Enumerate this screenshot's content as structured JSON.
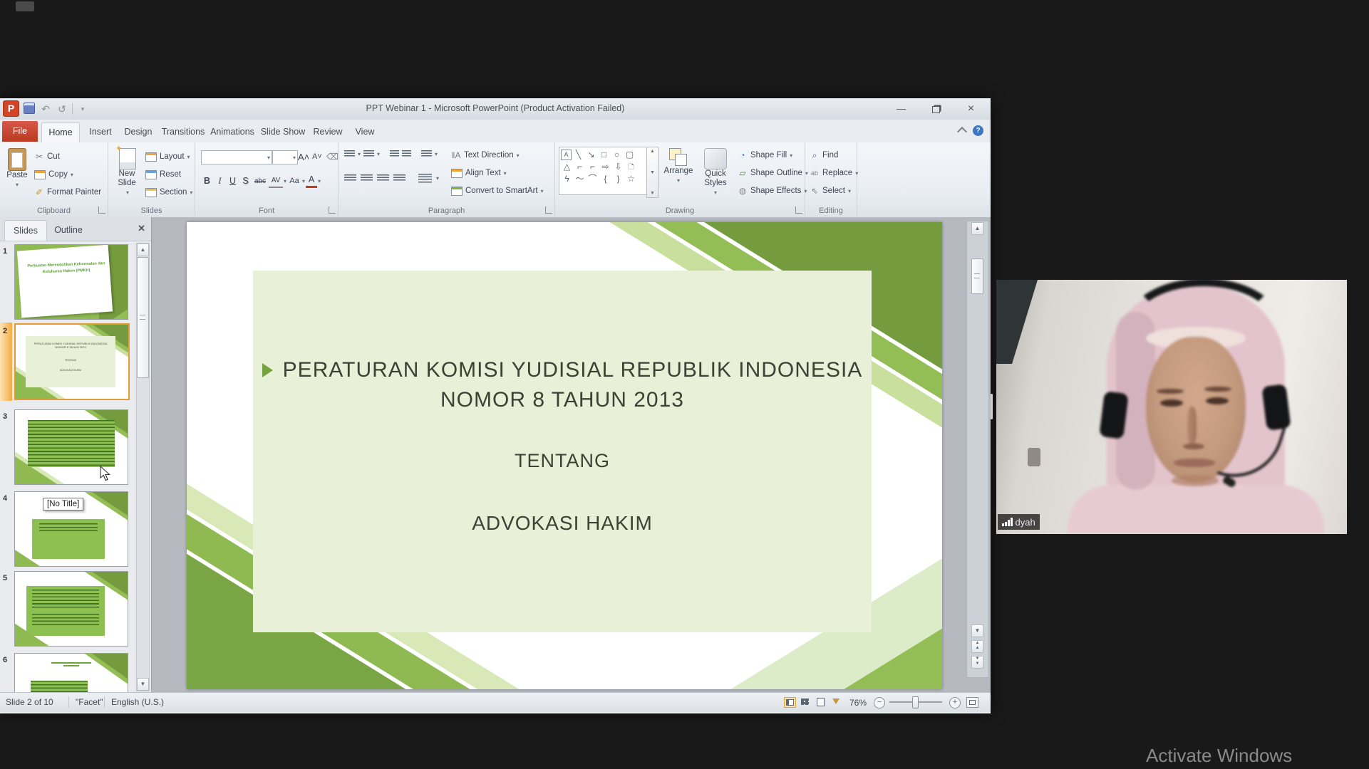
{
  "titlebar": {
    "title": "PPT Webinar 1 - Microsoft PowerPoint (Product Activation Failed)"
  },
  "tabs": {
    "file": "File",
    "items": [
      "Home",
      "Insert",
      "Design",
      "Transitions",
      "Animations",
      "Slide Show",
      "Review",
      "View"
    ]
  },
  "ribbon": {
    "clipboard": {
      "label": "Clipboard",
      "paste": "Paste",
      "cut": "Cut",
      "copy": "Copy",
      "format_painter": "Format Painter"
    },
    "slides": {
      "label": "Slides",
      "new_slide": "New Slide",
      "layout": "Layout",
      "reset": "Reset",
      "section": "Section"
    },
    "font": {
      "label": "Font",
      "bold": "B",
      "italic": "I",
      "underline": "U",
      "shadow": "S",
      "strike": "abc",
      "spacing": "AV",
      "case": "Aa",
      "color": "A"
    },
    "paragraph": {
      "label": "Paragraph",
      "text_direction": "Text Direction",
      "align_text": "Align Text",
      "convert_smartart": "Convert to SmartArt"
    },
    "drawing": {
      "label": "Drawing",
      "arrange": "Arrange",
      "quick_styles": "Quick Styles",
      "shape_fill": "Shape Fill",
      "shape_outline": "Shape Outline",
      "shape_effects": "Shape Effects"
    },
    "editing": {
      "label": "Editing",
      "find": "Find",
      "replace": "Replace",
      "select": "Select"
    }
  },
  "slides_panel": {
    "tab_slides": "Slides",
    "tab_outline": "Outline",
    "tooltip": "[No Title]",
    "numbers": [
      "1",
      "2",
      "3",
      "4",
      "5",
      "6"
    ],
    "thumb1_title": "Perbuatan Merendahkan Kehormatan dan Keluhuran Hakim (PMKH)",
    "thumb2_line1": "PERATURAN KOMISI YUDISIAL REPUBLIK INDONESIA NOMOR 8 TAHUN 2013",
    "thumb2_line2": "TENTANG",
    "thumb2_line3": "ADVOKASI HAKIM"
  },
  "slide": {
    "title_line1": "PERATURAN KOMISI YUDISIAL REPUBLIK INDONESIA",
    "title_line2": "NOMOR 8 TAHUN 2013",
    "mid": "TENTANG",
    "bottom": "ADVOKASI HAKIM"
  },
  "statusbar": {
    "slide_info": "Slide 2 of 10",
    "theme": "\"Facet\"",
    "language": "English (U.S.)",
    "zoom_level": "76%"
  },
  "webcam": {
    "name": "dyah"
  },
  "os": {
    "activate": "Activate Windows"
  }
}
